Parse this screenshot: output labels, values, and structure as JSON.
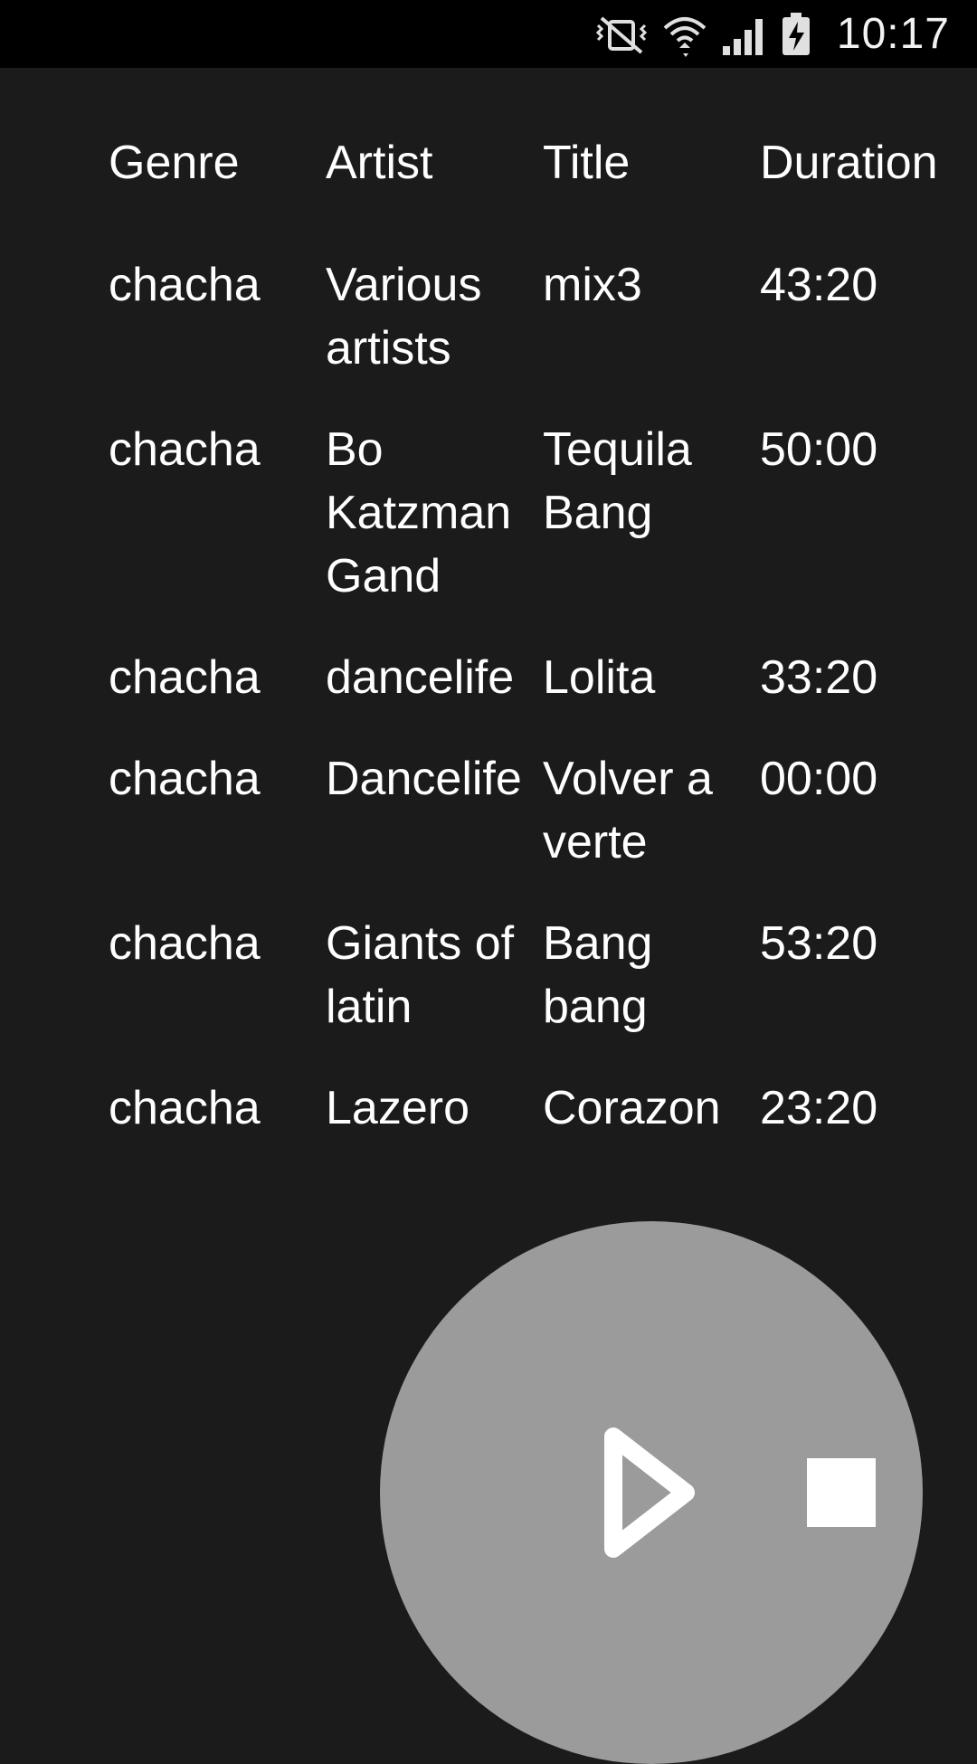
{
  "status_bar": {
    "time": "10:17",
    "icons": [
      "vibrate-mute-icon",
      "wifi-icon",
      "signal-icon",
      "battery-charging-icon"
    ]
  },
  "table": {
    "headers": {
      "genre": "Genre",
      "artist": "Artist",
      "title": "Title",
      "duration": "Duration"
    },
    "rows": [
      {
        "genre": "chacha",
        "artist": "Various artists",
        "title": "mix3",
        "duration": "43:20"
      },
      {
        "genre": "chacha",
        "artist": "Bo KatzmanGand",
        "title": "Tequila Bang",
        "duration": "50:00"
      },
      {
        "genre": "chacha",
        "artist": "dancelife",
        "title": "Lolita",
        "duration": "33:20"
      },
      {
        "genre": "chacha",
        "artist": "Dancelife",
        "title": "Volver a verte",
        "duration": "00:00"
      },
      {
        "genre": "chacha",
        "artist": "Giants of latin",
        "title": "Bang bang",
        "duration": "53:20"
      },
      {
        "genre": "chacha",
        "artist": "Lazero",
        "title": "Corazon",
        "duration": "23:20"
      }
    ]
  },
  "player": {
    "icons": [
      "play-icon",
      "stop-icon"
    ],
    "fab_color": "#9b9b9b",
    "icon_color": "#ffffff"
  }
}
